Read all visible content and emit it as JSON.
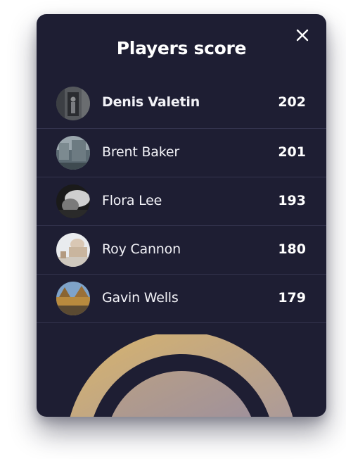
{
  "modal": {
    "title": "Players score",
    "close_icon": "close-icon",
    "accent_gradient": [
      "#d8b46c",
      "#a596a0"
    ]
  },
  "players": [
    {
      "name": "Denis Valetin",
      "score": "202",
      "highlight": true
    },
    {
      "name": "Brent Baker",
      "score": "201",
      "highlight": false
    },
    {
      "name": "Flora Lee",
      "score": "193",
      "highlight": false
    },
    {
      "name": "Roy Cannon",
      "score": "180",
      "highlight": false
    },
    {
      "name": "Gavin Wells",
      "score": "179",
      "highlight": false
    }
  ]
}
